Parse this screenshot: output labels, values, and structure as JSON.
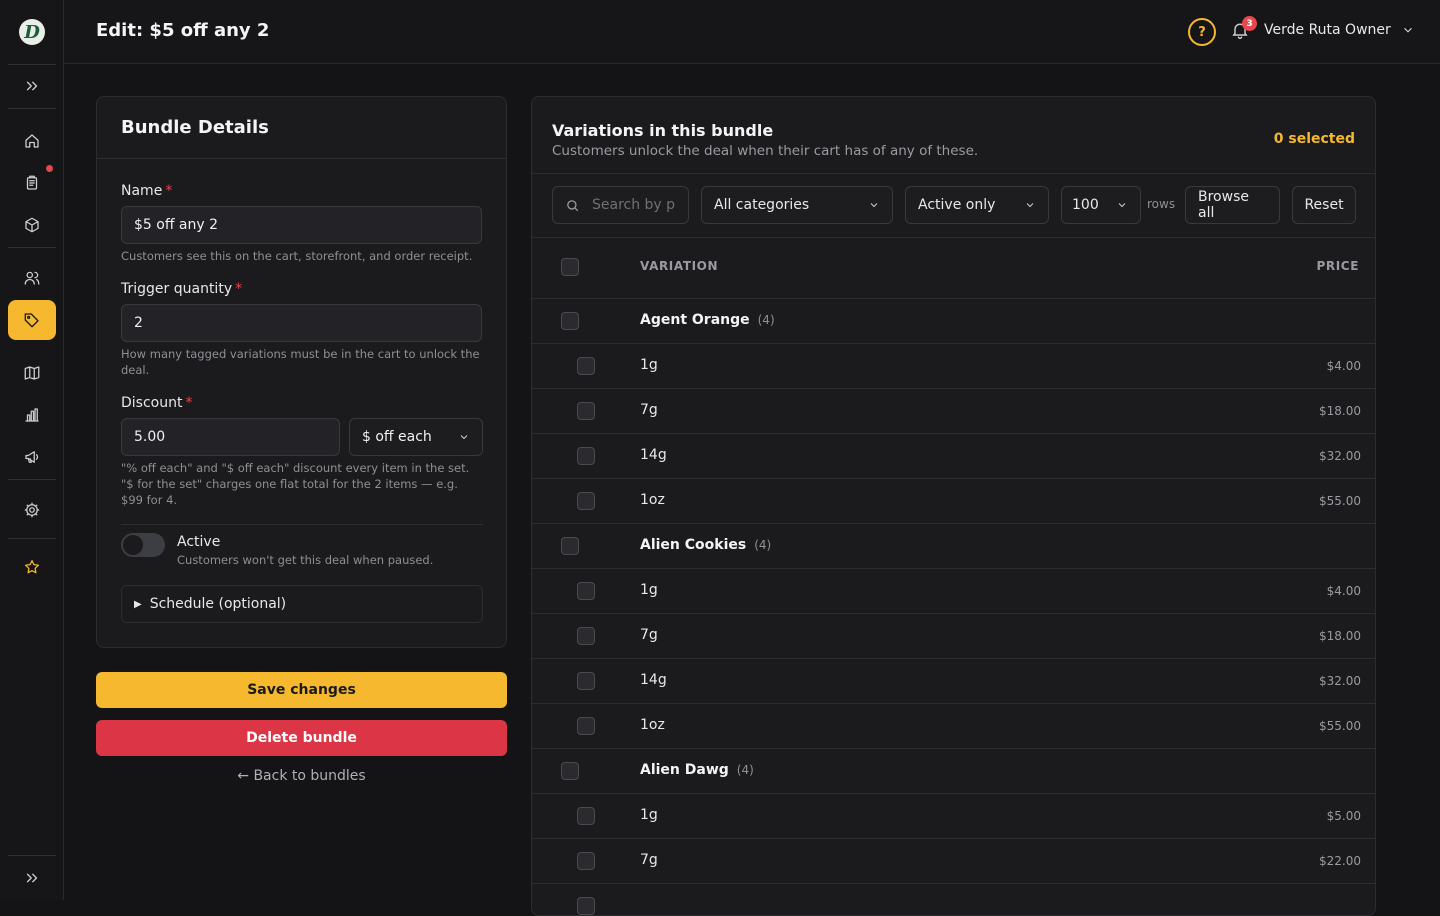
{
  "app": {
    "logo_letter": "D"
  },
  "header": {
    "title": "Edit: $5 off any 2",
    "help_symbol": "?",
    "notification_count": "3",
    "user_name": "Verde Ruta Owner"
  },
  "sidebar": {
    "items": [
      {
        "icon": "expand-icon"
      },
      {
        "icon": "home-icon"
      },
      {
        "icon": "orders-icon",
        "badge": true
      },
      {
        "icon": "box-icon"
      },
      {
        "icon": "users-icon"
      },
      {
        "icon": "tag-icon",
        "active": true
      },
      {
        "icon": "map-icon"
      },
      {
        "icon": "chart-icon"
      },
      {
        "icon": "megaphone-icon"
      },
      {
        "icon": "gear-icon"
      },
      {
        "icon": "star-icon"
      },
      {
        "icon": "collapse-icon"
      }
    ]
  },
  "details": {
    "heading": "Bundle Details",
    "name_label": "Name",
    "name_value": "$5 off any 2",
    "name_help": "Customers see this on the cart, storefront, and order receipt.",
    "trigger_label": "Trigger quantity",
    "trigger_value": "2",
    "trigger_help": "How many tagged variations must be in the cart to unlock the deal.",
    "discount_label": "Discount",
    "discount_value": "5.00",
    "discount_type": "$ off each",
    "discount_help": "\"% off each\" and \"$ off each\" discount every item in the set. \"$ for the set\" charges one flat total for the 2 items — e.g. $99 for 4.",
    "active_label": "Active",
    "active_help": "Customers won't get this deal when paused.",
    "active_on": false,
    "schedule_label": "Schedule (optional)",
    "required_mark": "*"
  },
  "actions": {
    "save": "Save changes",
    "delete": "Delete bundle",
    "back": "← Back to bundles"
  },
  "variations": {
    "title": "Variations in this bundle",
    "subtitle": "Customers unlock the deal when their cart has of any of these.",
    "selected": "0 selected",
    "search_placeholder": "Search by p",
    "category": "All categories",
    "status": "Active only",
    "rows_value": "100",
    "rows_label": "rows",
    "browse_all": "Browse all",
    "reset": "Reset",
    "col_variation": "VARIATION",
    "col_price": "PRICE",
    "groups": [
      {
        "name": "Agent Orange",
        "count": "(4)",
        "items": [
          {
            "name": "1g",
            "price": "$4.00"
          },
          {
            "name": "7g",
            "price": "$18.00"
          },
          {
            "name": "14g",
            "price": "$32.00"
          },
          {
            "name": "1oz",
            "price": "$55.00"
          }
        ]
      },
      {
        "name": "Alien Cookies",
        "count": "(4)",
        "items": [
          {
            "name": "1g",
            "price": "$4.00"
          },
          {
            "name": "7g",
            "price": "$18.00"
          },
          {
            "name": "14g",
            "price": "$32.00"
          },
          {
            "name": "1oz",
            "price": "$55.00"
          }
        ]
      },
      {
        "name": "Alien Dawg",
        "count": "(4)",
        "items": [
          {
            "name": "1g",
            "price": "$5.00"
          },
          {
            "name": "7g",
            "price": "$22.00"
          }
        ]
      }
    ]
  }
}
